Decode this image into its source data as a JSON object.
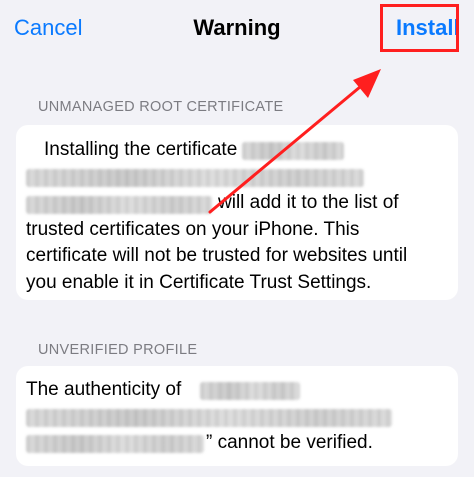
{
  "nav": {
    "cancel": "Cancel",
    "title": "Warning",
    "install": "Install"
  },
  "sections": {
    "root_cert": {
      "header": "UNMANAGED ROOT CERTIFICATE",
      "lines": [
        "Installing the certificate",
        "will add it to the list of",
        "trusted certificates on your iPhone. This",
        "certificate will not be trusted for websites until",
        "you enable it in Certificate Trust Settings."
      ]
    },
    "profile": {
      "header": "UNVERIFIED PROFILE",
      "lines": [
        "The authenticity of",
        "” cannot be verified."
      ]
    }
  },
  "colors": {
    "accent": "#0a7aff",
    "annotation": "#ff1f1f",
    "background": "#f2f2f7",
    "card": "#ffffff",
    "section_header": "#7c7c82"
  }
}
